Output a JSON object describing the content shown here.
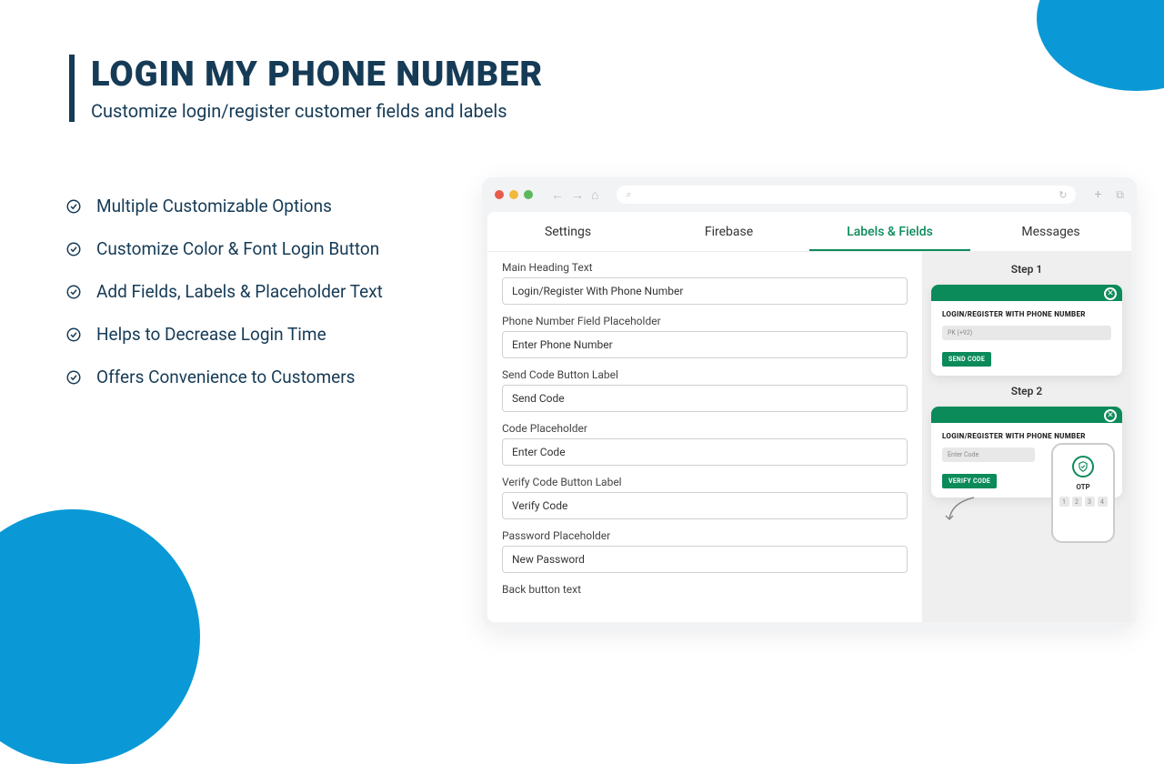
{
  "header": {
    "title": "LOGIN MY PHONE NUMBER",
    "subtitle": "Customize login/register customer fields and labels"
  },
  "features": [
    "Multiple Customizable Options",
    "Customize Color & Font Login Button",
    "Add Fields, Labels & Placeholder Text",
    "Helps to Decrease Login Time",
    "Offers Convenience to Customers"
  ],
  "tabs": [
    "Settings",
    "Firebase",
    "Labels & Fields",
    "Messages"
  ],
  "activeTab": 2,
  "form": [
    {
      "label": "Main Heading Text",
      "value": "Login/Register With Phone Number"
    },
    {
      "label": "Phone Number Field Placeholder",
      "value": "Enter Phone Number"
    },
    {
      "label": "Send Code Button Label",
      "value": "Send Code"
    },
    {
      "label": "Code Placeholder",
      "value": "Enter Code"
    },
    {
      "label": "Verify Code Button Label",
      "value": "Verify Code"
    },
    {
      "label": "Password Placeholder",
      "value": "New Password"
    },
    {
      "label": "Back button text",
      "value": ""
    }
  ],
  "preview": {
    "step1": {
      "label": "Step 1",
      "title": "LOGIN/REGISTER WITH PHONE NUMBER",
      "field": "PK (+92)",
      "button": "SEND CODE"
    },
    "step2": {
      "label": "Step 2",
      "title": "LOGIN/REGISTER WITH PHONE NUMBER",
      "field": "Enter Code",
      "button": "VERIFY CODE",
      "otpLabel": "OTP",
      "otp": [
        "1",
        "2",
        "3",
        "4"
      ]
    }
  },
  "colors": {
    "accent": "#0b8a5a",
    "brand": "#163b56",
    "blue": "#0a99d6"
  }
}
